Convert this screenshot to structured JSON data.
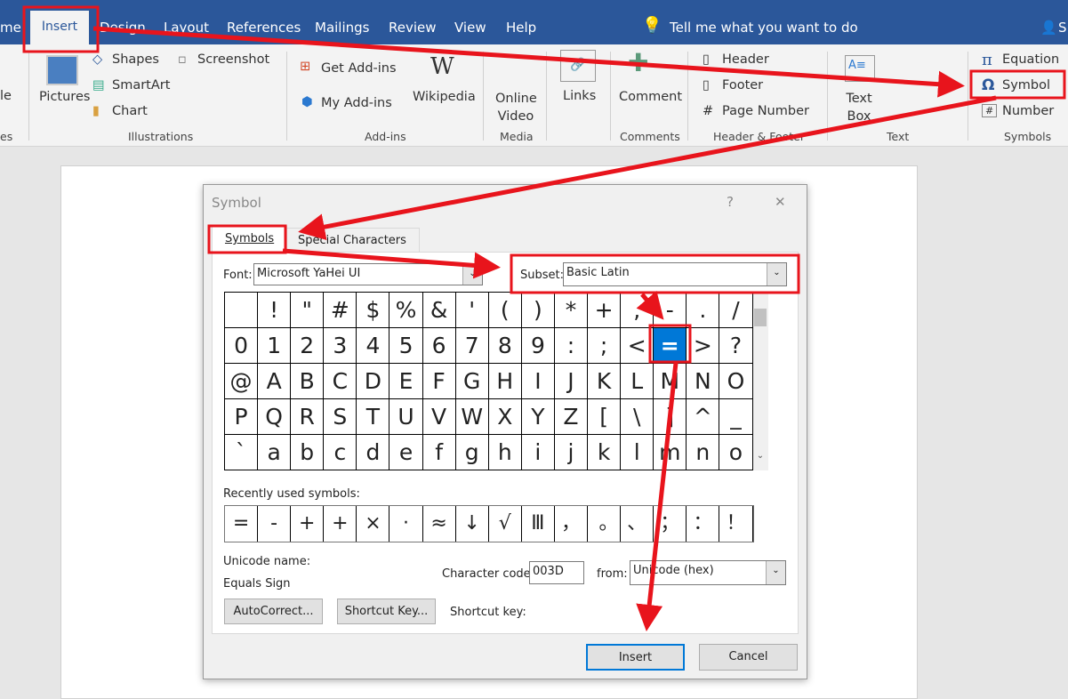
{
  "tabs": [
    "me",
    "Insert",
    "Design",
    "Layout",
    "References",
    "Mailings",
    "Review",
    "View",
    "Help"
  ],
  "tell_me": "Tell me what you want to do",
  "share": "S",
  "ribbon": {
    "table_partial": "le",
    "tables_group_partial": "es",
    "pictures": "Pictures",
    "shapes": "Shapes",
    "smartart": "SmartArt",
    "chart": "Chart",
    "screenshot": "Screenshot",
    "illustrations": "Illustrations",
    "get_addins": "Get Add-ins",
    "my_addins": "My Add-ins",
    "wikipedia": "Wikipedia",
    "addins": "Add-ins",
    "online_video": "Online Video",
    "media": "Media",
    "links": "Links",
    "comment": "Comment",
    "comments": "Comments",
    "header": "Header",
    "footer": "Footer",
    "page_number": "Page Number",
    "header_footer": "Header & Footer",
    "text_box": "Text Box",
    "text": "Text",
    "equation": "Equation",
    "symbol": "Symbol",
    "number": "Number",
    "symbols": "Symbols"
  },
  "dialog": {
    "title": "Symbol",
    "help": "?",
    "close": "✕",
    "tabs": [
      "Symbols",
      "Special Characters"
    ],
    "font_label": "Font:",
    "font_value": "Microsoft YaHei UI",
    "subset_label": "Subset:",
    "subset_value": "Basic Latin",
    "grid": [
      " ",
      "!",
      "\"",
      "#",
      "$",
      "%",
      "&",
      "'",
      "(",
      ")",
      "*",
      "+",
      ",",
      "-",
      ".",
      "/",
      "0",
      "1",
      "2",
      "3",
      "4",
      "5",
      "6",
      "7",
      "8",
      "9",
      ":",
      ";",
      "<",
      "=",
      ">",
      "?",
      "@",
      "A",
      "B",
      "C",
      "D",
      "E",
      "F",
      "G",
      "H",
      "I",
      "J",
      "K",
      "L",
      "M",
      "N",
      "O",
      "P",
      "Q",
      "R",
      "S",
      "T",
      "U",
      "V",
      "W",
      "X",
      "Y",
      "Z",
      "[",
      "\\",
      "]",
      "^",
      "_",
      "`",
      "a",
      "b",
      "c",
      "d",
      "e",
      "f",
      "g",
      "h",
      "i",
      "j",
      "k",
      "l",
      "m",
      "n",
      "o"
    ],
    "selected": "=",
    "recent_label": "Recently used symbols:",
    "recent": [
      "=",
      "-",
      "+",
      "+",
      "×",
      "·",
      "≈",
      "↓",
      "√",
      "Ⅲ",
      "，",
      "｡",
      "、",
      "；",
      "：",
      "！"
    ],
    "unicode_name_label": "Unicode name:",
    "unicode_name": "Equals Sign",
    "char_code_label": "Character code:",
    "char_code": "003D",
    "from_label": "from:",
    "from_value": "Unicode (hex)",
    "autocorrect": "AutoCorrect...",
    "shortcut_key_btn": "Shortcut Key...",
    "shortcut_key_label": "Shortcut key:",
    "insert": "Insert",
    "cancel": "Cancel"
  },
  "annotation_color": "#e8141c"
}
